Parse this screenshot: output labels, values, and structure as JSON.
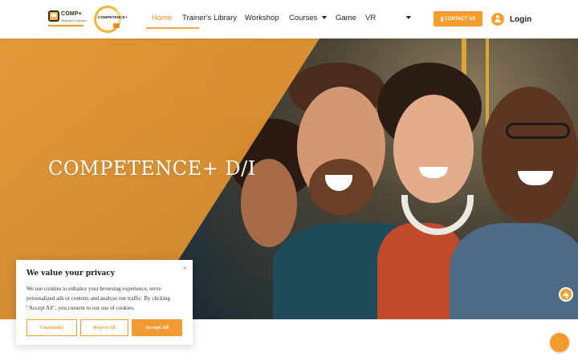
{
  "header": {
    "logo_comp_text": "COMP+",
    "logo_comp_sub": "Diversity & Inclusion",
    "logo_competence_text": "COMPETENCE+",
    "nav": [
      {
        "label": "Home",
        "active": true,
        "dropdown": false
      },
      {
        "label": "Trainer's Library",
        "active": false,
        "dropdown": false
      },
      {
        "label": "Workshop",
        "active": false,
        "dropdown": false
      },
      {
        "label": "Courses",
        "active": false,
        "dropdown": true
      },
      {
        "label": "Game",
        "active": false,
        "dropdown": false
      },
      {
        "label": "VR",
        "active": false,
        "dropdown": true
      }
    ],
    "contact_label": "CONTACT US",
    "login_label": "Login"
  },
  "hero": {
    "title": "COMPETENCE+ D/I"
  },
  "cookie_banner": {
    "title": "We value your privacy",
    "text": "We use cookies to enhance your browsing experience, serve personalized ads or content, and analyze our traffic. By clicking \"Accept All\", you consent to our use of cookies.",
    "close_symbol": "×",
    "customize_label": "Customize",
    "reject_label": "Reject All",
    "accept_label": "Accept All"
  },
  "colors": {
    "accent": "#f49c2f",
    "overlay": "#f0a13a",
    "text_dark": "#222222"
  }
}
